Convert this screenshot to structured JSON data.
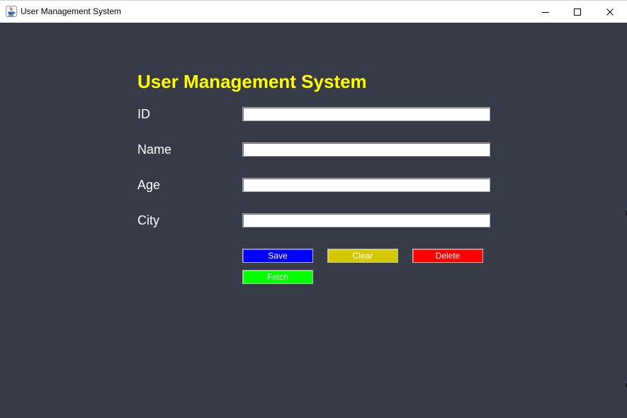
{
  "window": {
    "title": "User Management System",
    "icon": "java-cup-icon"
  },
  "window_controls": {
    "minimize_icon": "minimize-icon",
    "maximize_icon": "maximize-icon",
    "close_icon": "close-icon"
  },
  "form": {
    "heading": "User Management System",
    "fields": [
      {
        "label": "ID",
        "value": ""
      },
      {
        "label": "Name",
        "value": ""
      },
      {
        "label": "Age",
        "value": ""
      },
      {
        "label": "City",
        "value": ""
      }
    ]
  },
  "buttons": {
    "save": "Save",
    "clear": "Clear",
    "delete": "Delete",
    "fetch": "Fetch"
  },
  "colors": {
    "background": "#373b48",
    "heading": "#ffff00",
    "save": "#0000ff",
    "clear": "#d5c800",
    "delete": "#ff0000",
    "fetch": "#00ff00"
  }
}
